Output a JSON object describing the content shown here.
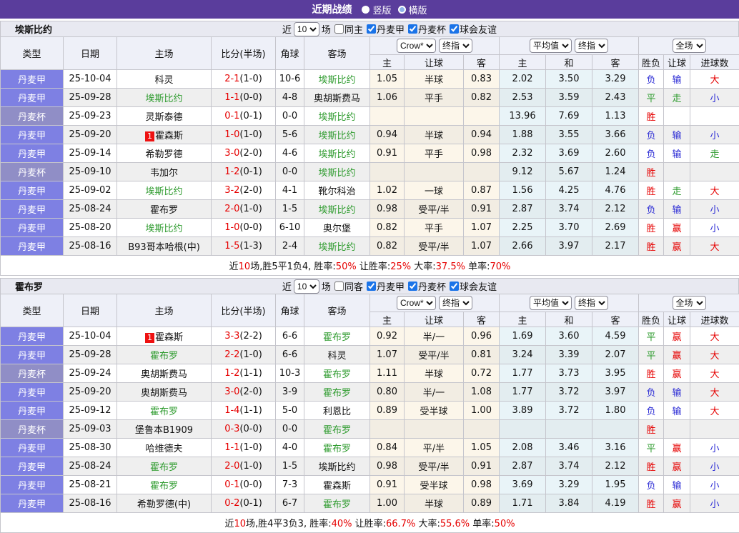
{
  "title_bar": {
    "title": "近期战绩",
    "vertical": "竖版",
    "horizontal": "横版"
  },
  "colors": {
    "accent_purple": "#5a3d9c",
    "league_type_cell": "#7e80e3",
    "cup_type_cell": "#908ec6",
    "win_red": "#e60000",
    "draw_green": "#2e9b2e",
    "lose_blue": "#2b2bd5",
    "team_highlight_green": "#2e9b2e"
  },
  "table_columns": {
    "type": "类型",
    "date": "日期",
    "home": "主场",
    "score": "比分(半场)",
    "corner": "角球",
    "away": "客场",
    "odds_home": "主",
    "odds_handicap": "让球",
    "odds_away": "客",
    "avg_home": "主",
    "avg_draw": "和",
    "avg_away": "客",
    "result": "胜负",
    "result_handicap": "让球",
    "result_goals": "进球数"
  },
  "dropdowns": {
    "bookmaker": "Crow*",
    "final_index": "终指",
    "average": "平均值",
    "full_match": "全场"
  },
  "sections": [
    {
      "team": "埃斯比约",
      "filters": {
        "near": "近",
        "count": "10",
        "unit": "场",
        "same": {
          "label": "同主",
          "checked": false
        },
        "competitions": [
          {
            "label": "丹麦甲",
            "checked": true
          },
          {
            "label": "丹麦杯",
            "checked": true
          },
          {
            "label": "球会友谊",
            "checked": true
          }
        ]
      },
      "rows": [
        {
          "type": "丹麦甲",
          "date": "25-10-04",
          "home": {
            "name": "科灵"
          },
          "score": "2-1",
          "half": "(1-0)",
          "corner": "10-6",
          "away": {
            "name": "埃斯比约",
            "highlight": true
          },
          "odds": [
            "1.05",
            "半球",
            "0.83"
          ],
          "avg": [
            "2.02",
            "3.50",
            "3.29"
          ],
          "results": [
            "负",
            "输",
            "大"
          ]
        },
        {
          "type": "丹麦甲",
          "date": "25-09-28",
          "home": {
            "name": "埃斯比约",
            "highlight": true
          },
          "score": "1-1",
          "half": "(0-0)",
          "corner": "4-8",
          "away": {
            "name": "奥胡斯费马"
          },
          "odds": [
            "1.06",
            "平手",
            "0.82"
          ],
          "avg": [
            "2.53",
            "3.59",
            "2.43"
          ],
          "results": [
            "平",
            "走",
            "小"
          ]
        },
        {
          "type": "丹麦杯",
          "date": "25-09-23",
          "home": {
            "name": "灵斯泰德"
          },
          "score": "0-1",
          "half": "(0-1)",
          "corner": "0-0",
          "away": {
            "name": "埃斯比约",
            "highlight": true
          },
          "odds": [
            "",
            "",
            ""
          ],
          "avg": [
            "13.96",
            "7.69",
            "1.13"
          ],
          "results": [
            "胜",
            "",
            ""
          ]
        },
        {
          "type": "丹麦甲",
          "date": "25-09-20",
          "home": {
            "name": "霍森斯",
            "badge": "1"
          },
          "score": "1-0",
          "half": "(1-0)",
          "corner": "5-6",
          "away": {
            "name": "埃斯比约",
            "highlight": true
          },
          "odds": [
            "0.94",
            "半球",
            "0.94"
          ],
          "avg": [
            "1.88",
            "3.55",
            "3.66"
          ],
          "results": [
            "负",
            "输",
            "小"
          ]
        },
        {
          "type": "丹麦甲",
          "date": "25-09-14",
          "home": {
            "name": "希勒罗德"
          },
          "score": "3-0",
          "half": "(2-0)",
          "corner": "4-6",
          "away": {
            "name": "埃斯比约",
            "highlight": true
          },
          "odds": [
            "0.91",
            "平手",
            "0.98"
          ],
          "avg": [
            "2.32",
            "3.69",
            "2.60"
          ],
          "results": [
            "负",
            "输",
            "走"
          ]
        },
        {
          "type": "丹麦杯",
          "date": "25-09-10",
          "home": {
            "name": "韦加尔"
          },
          "score": "1-2",
          "half": "(0-1)",
          "corner": "0-0",
          "away": {
            "name": "埃斯比约",
            "highlight": true
          },
          "odds": [
            "",
            "",
            ""
          ],
          "avg": [
            "9.12",
            "5.67",
            "1.24"
          ],
          "results": [
            "胜",
            "",
            ""
          ]
        },
        {
          "type": "丹麦甲",
          "date": "25-09-02",
          "home": {
            "name": "埃斯比约",
            "highlight": true
          },
          "score": "3-2",
          "half": "(2-0)",
          "corner": "4-1",
          "away": {
            "name": "靴尔科治"
          },
          "odds": [
            "1.02",
            "一球",
            "0.87"
          ],
          "avg": [
            "1.56",
            "4.25",
            "4.76"
          ],
          "results": [
            "胜",
            "走",
            "大"
          ]
        },
        {
          "type": "丹麦甲",
          "date": "25-08-24",
          "home": {
            "name": "霍布罗"
          },
          "score": "2-0",
          "half": "(1-0)",
          "corner": "1-5",
          "away": {
            "name": "埃斯比约",
            "highlight": true
          },
          "odds": [
            "0.98",
            "受平/半",
            "0.91"
          ],
          "avg": [
            "2.87",
            "3.74",
            "2.12"
          ],
          "results": [
            "负",
            "输",
            "小"
          ]
        },
        {
          "type": "丹麦甲",
          "date": "25-08-20",
          "home": {
            "name": "埃斯比约",
            "highlight": true
          },
          "score": "1-0",
          "half": "(0-0)",
          "corner": "6-10",
          "away": {
            "name": "奥尔堡"
          },
          "odds": [
            "0.82",
            "平手",
            "1.07"
          ],
          "avg": [
            "2.25",
            "3.70",
            "2.69"
          ],
          "results": [
            "胜",
            "赢",
            "小"
          ]
        },
        {
          "type": "丹麦甲",
          "date": "25-08-16",
          "home": {
            "name": "B93哥本哈根(中)"
          },
          "score": "1-5",
          "half": "(1-3)",
          "corner": "2-4",
          "away": {
            "name": "埃斯比约",
            "highlight": true
          },
          "odds": [
            "0.82",
            "受平/半",
            "1.07"
          ],
          "avg": [
            "2.66",
            "3.97",
            "2.17"
          ],
          "results": [
            "胜",
            "赢",
            "大"
          ]
        }
      ],
      "summary": [
        {
          "text": "近"
        },
        {
          "text": "10",
          "red": true
        },
        {
          "text": "场,胜5平1负4, 胜率:"
        },
        {
          "text": "50%",
          "red": true
        },
        {
          "text": " 让胜率:"
        },
        {
          "text": "25%",
          "red": true
        },
        {
          "text": " 大率:"
        },
        {
          "text": "37.5%",
          "red": true
        },
        {
          "text": " 单率:"
        },
        {
          "text": "70%",
          "red": true
        }
      ]
    },
    {
      "team": "霍布罗",
      "filters": {
        "near": "近",
        "count": "10",
        "unit": "场",
        "same": {
          "label": "同客",
          "checked": false
        },
        "competitions": [
          {
            "label": "丹麦甲",
            "checked": true
          },
          {
            "label": "丹麦杯",
            "checked": true
          },
          {
            "label": "球会友谊",
            "checked": true
          }
        ]
      },
      "rows": [
        {
          "type": "丹麦甲",
          "date": "25-10-04",
          "home": {
            "name": "霍森斯",
            "badge": "1"
          },
          "score": "3-3",
          "half": "(2-2)",
          "corner": "6-6",
          "away": {
            "name": "霍布罗",
            "highlight": true
          },
          "odds": [
            "0.92",
            "半/一",
            "0.96"
          ],
          "avg": [
            "1.69",
            "3.60",
            "4.59"
          ],
          "results": [
            "平",
            "赢",
            "大"
          ]
        },
        {
          "type": "丹麦甲",
          "date": "25-09-28",
          "home": {
            "name": "霍布罗",
            "highlight": true
          },
          "score": "2-2",
          "half": "(1-0)",
          "corner": "6-6",
          "away": {
            "name": "科灵"
          },
          "odds": [
            "1.07",
            "受平/半",
            "0.81"
          ],
          "avg": [
            "3.24",
            "3.39",
            "2.07"
          ],
          "results": [
            "平",
            "赢",
            "大"
          ]
        },
        {
          "type": "丹麦杯",
          "date": "25-09-24",
          "home": {
            "name": "奥胡斯费马"
          },
          "score": "1-2",
          "half": "(1-1)",
          "corner": "10-3",
          "away": {
            "name": "霍布罗",
            "highlight": true
          },
          "odds": [
            "1.11",
            "半球",
            "0.72"
          ],
          "avg": [
            "1.77",
            "3.73",
            "3.95"
          ],
          "results": [
            "胜",
            "赢",
            "大"
          ]
        },
        {
          "type": "丹麦甲",
          "date": "25-09-20",
          "home": {
            "name": "奥胡斯费马"
          },
          "score": "3-0",
          "half": "(2-0)",
          "corner": "3-9",
          "away": {
            "name": "霍布罗",
            "highlight": true
          },
          "odds": [
            "0.80",
            "半/一",
            "1.08"
          ],
          "avg": [
            "1.77",
            "3.72",
            "3.97"
          ],
          "results": [
            "负",
            "输",
            "大"
          ]
        },
        {
          "type": "丹麦甲",
          "date": "25-09-12",
          "home": {
            "name": "霍布罗",
            "highlight": true
          },
          "score": "1-4",
          "half": "(1-1)",
          "corner": "5-0",
          "away": {
            "name": "利恩比"
          },
          "odds": [
            "0.89",
            "受半球",
            "1.00"
          ],
          "avg": [
            "3.89",
            "3.72",
            "1.80"
          ],
          "results": [
            "负",
            "输",
            "大"
          ]
        },
        {
          "type": "丹麦杯",
          "date": "25-09-03",
          "home": {
            "name": "堡鲁本B1909"
          },
          "score": "0-3",
          "half": "(0-0)",
          "corner": "0-0",
          "away": {
            "name": "霍布罗",
            "highlight": true
          },
          "odds": [
            "",
            "",
            ""
          ],
          "avg": [
            "",
            "",
            ""
          ],
          "results": [
            "胜",
            "",
            ""
          ]
        },
        {
          "type": "丹麦甲",
          "date": "25-08-30",
          "home": {
            "name": "哈维德夫"
          },
          "score": "1-1",
          "half": "(1-0)",
          "corner": "4-0",
          "away": {
            "name": "霍布罗",
            "highlight": true
          },
          "odds": [
            "0.84",
            "平/半",
            "1.05"
          ],
          "avg": [
            "2.08",
            "3.46",
            "3.16"
          ],
          "results": [
            "平",
            "赢",
            "小"
          ]
        },
        {
          "type": "丹麦甲",
          "date": "25-08-24",
          "home": {
            "name": "霍布罗",
            "highlight": true
          },
          "score": "2-0",
          "half": "(1-0)",
          "corner": "1-5",
          "away": {
            "name": "埃斯比约"
          },
          "odds": [
            "0.98",
            "受平/半",
            "0.91"
          ],
          "avg": [
            "2.87",
            "3.74",
            "2.12"
          ],
          "results": [
            "胜",
            "赢",
            "小"
          ]
        },
        {
          "type": "丹麦甲",
          "date": "25-08-21",
          "home": {
            "name": "霍布罗",
            "highlight": true
          },
          "score": "0-1",
          "half": "(0-0)",
          "corner": "7-3",
          "away": {
            "name": "霍森斯"
          },
          "odds": [
            "0.91",
            "受半球",
            "0.98"
          ],
          "avg": [
            "3.69",
            "3.29",
            "1.95"
          ],
          "results": [
            "负",
            "输",
            "小"
          ]
        },
        {
          "type": "丹麦甲",
          "date": "25-08-16",
          "home": {
            "name": "希勒罗德(中)"
          },
          "score": "0-2",
          "half": "(0-1)",
          "corner": "6-7",
          "away": {
            "name": "霍布罗",
            "highlight": true
          },
          "odds": [
            "1.00",
            "半球",
            "0.89"
          ],
          "avg": [
            "1.71",
            "3.84",
            "4.19"
          ],
          "results": [
            "胜",
            "赢",
            "小"
          ]
        }
      ],
      "summary": [
        {
          "text": "近"
        },
        {
          "text": "10",
          "red": true
        },
        {
          "text": "场,胜4平3负3, 胜率:"
        },
        {
          "text": "40%",
          "red": true
        },
        {
          "text": " 让胜率:"
        },
        {
          "text": "66.7%",
          "red": true
        },
        {
          "text": " 大率:"
        },
        {
          "text": "55.6%",
          "red": true
        },
        {
          "text": " 单率:"
        },
        {
          "text": "50%",
          "red": true
        }
      ]
    }
  ]
}
